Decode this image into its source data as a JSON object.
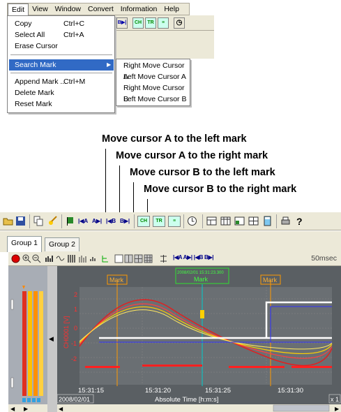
{
  "menubar": {
    "items": [
      "Edit",
      "View",
      "Window",
      "Convert",
      "Information",
      "Help"
    ]
  },
  "edit_menu": {
    "items": [
      {
        "label": "Copy",
        "shortcut": "Ctrl+C"
      },
      {
        "label": "Select All",
        "shortcut": "Ctrl+A"
      },
      {
        "label": "Erase Cursor",
        "shortcut": ""
      },
      {
        "label": "Search Mark",
        "shortcut": ""
      },
      {
        "label": "Append Mark ...",
        "shortcut": "Ctrl+M"
      },
      {
        "label": "Delete Mark",
        "shortcut": ""
      },
      {
        "label": "Reset Mark",
        "shortcut": ""
      }
    ],
    "submenu_arrow": "▶"
  },
  "search_mark_submenu": {
    "items": [
      "Right Move Cursor A",
      "Left Move Cursor A",
      "Right Move Cursor B",
      "Left Move Cursor B"
    ]
  },
  "annotations": [
    "Move cursor A to the left mark",
    "Move cursor A to the right mark",
    "Move cursor B to the left mark",
    "Move cursor B to the right mark"
  ],
  "toolbar_button_labels": {
    "a_left": "|◀A",
    "a_right": "A▶|",
    "b_left": "|◀B",
    "b_right": "B▶|"
  },
  "tabs": [
    "Group 1",
    "Group 2"
  ],
  "graph_toolbar": {
    "cursor_labels": "|◀A A▶| |◀B B▶|",
    "timescale": "50msec"
  },
  "chart": {
    "marks": [
      "Mark",
      "Mark",
      "Mark"
    ],
    "cursor_time": "2008/02/01 15:31:23.300",
    "y_axis_label": "CH0001 [V]",
    "y_ticks": [
      "2",
      "1",
      "0",
      "-1",
      "-2"
    ],
    "x_ticks": [
      "15:31:15",
      "15:31:20",
      "15:31:25",
      "15:31:30"
    ],
    "date": "2008/02/01",
    "x_axis_label": "Absolute Time [h:m:s]",
    "zoom": "x 1"
  },
  "colors": {
    "menu_highlight": "#316ac5",
    "plot_bg": "#5a5f63",
    "cursor_line": "#00cccc",
    "mark_line": "#ff9900"
  }
}
